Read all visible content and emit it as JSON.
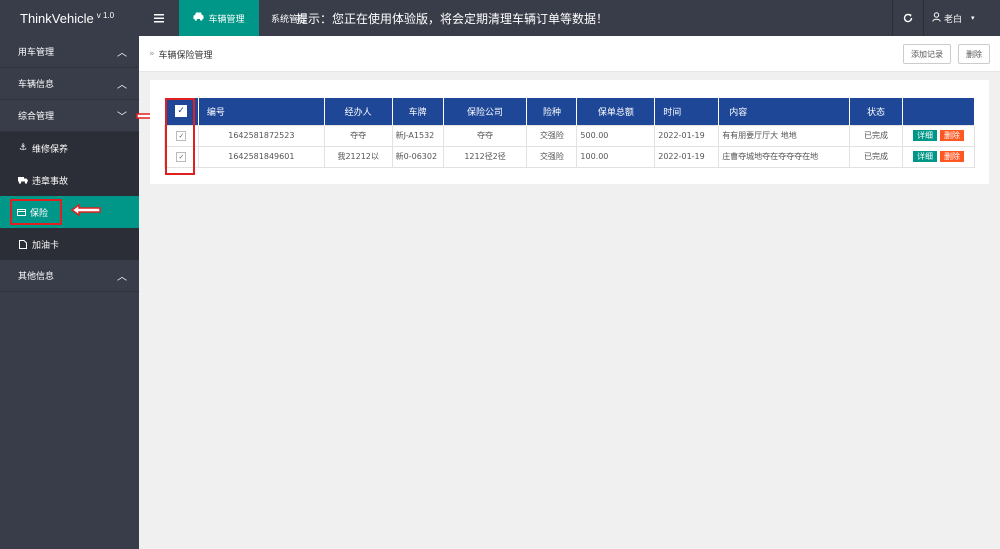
{
  "app": {
    "name": "ThinkVehicle",
    "version": "v 1.0"
  },
  "topbar": {
    "menu_icon": "hamburger-icon",
    "active_nav": {
      "label": "车辆管理",
      "icon": "car-icon"
    },
    "nav_item": "系统管理",
    "notice": "提示：您正在使用体验版，将会定期清理车辆订单等数据！",
    "refresh_icon": "refresh-icon",
    "user": "老白"
  },
  "sidebar": {
    "groups": [
      {
        "label": "用车管理",
        "chevron": "chevron-up-icon"
      },
      {
        "label": "车辆信息",
        "chevron": "chevron-up-icon"
      },
      {
        "label": "综合管理",
        "chevron": "chevron-down-icon"
      }
    ],
    "subitems": [
      {
        "label": "维修保养",
        "icon": "anchor-icon"
      },
      {
        "label": "违章事故",
        "icon": "truck-icon"
      },
      {
        "label": "保险",
        "icon": "card-icon"
      },
      {
        "label": "加油卡",
        "icon": "file-icon"
      }
    ],
    "other": {
      "label": "其他信息",
      "chevron": "chevron-up-icon"
    }
  },
  "breadcrumb": {
    "label": "车辆保险管理"
  },
  "actions": {
    "add": "添加记录",
    "delete": "删除"
  },
  "table": {
    "headers": [
      "编号",
      "经办人",
      "车牌",
      "保险公司",
      "险种",
      "保单总额",
      "时间",
      "内容",
      "状态"
    ],
    "rows": [
      {
        "id": "1642581872523",
        "handler": "夺夺",
        "plate": "新J-A1532",
        "company": "夺夺",
        "type": "交强险",
        "amount": "500.00",
        "date": "2022-01-19",
        "content": "有有朋要厅厅大 地地",
        "status": "已完成"
      },
      {
        "id": "1642581849601",
        "handler": "我21212以",
        "plate": "新0-06302",
        "company": "1212径2径",
        "type": "交强险",
        "amount": "100.00",
        "date": "2022-01-19",
        "content": "庄曹夺城地夺在夺夺夺在地",
        "status": "已完成"
      }
    ],
    "row_actions": {
      "detail": "详细",
      "delete": "删除"
    }
  },
  "colors": {
    "topbar": "#393d49",
    "accent": "#009688",
    "table_header": "#1e4797",
    "danger": "#ff5722",
    "highlight": "#e02020"
  }
}
